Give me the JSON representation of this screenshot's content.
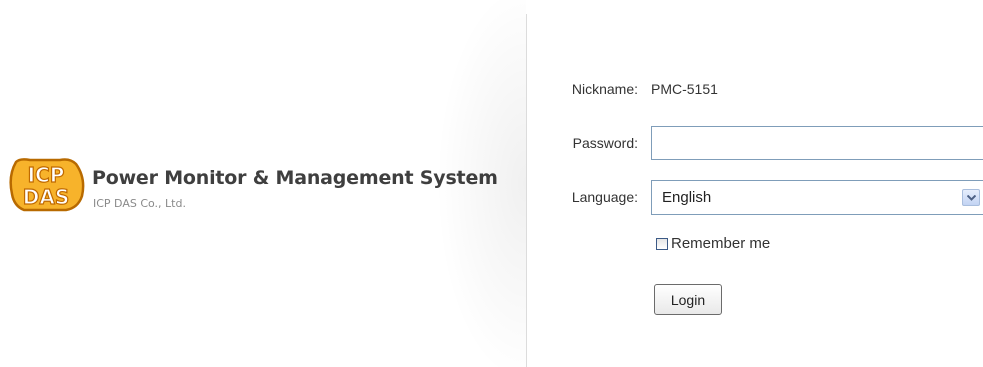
{
  "brand": {
    "logo_text": "ICP DAS",
    "title": "Power Monitor & Management System",
    "subtitle": "ICP DAS Co., Ltd.",
    "logo_colors": {
      "primary": "#f5a623",
      "outline": "#b36200"
    }
  },
  "form": {
    "nickname_label": "Nickname:",
    "nickname_value": "PMC-5151",
    "password_label": "Password:",
    "password_value": "",
    "language_label": "Language:",
    "language_value": "English",
    "remember_label": "Remember me",
    "remember_checked": false,
    "login_label": "Login"
  },
  "icons": {
    "dropdown": "chevron-down-icon",
    "checkbox": "checkbox-icon"
  }
}
